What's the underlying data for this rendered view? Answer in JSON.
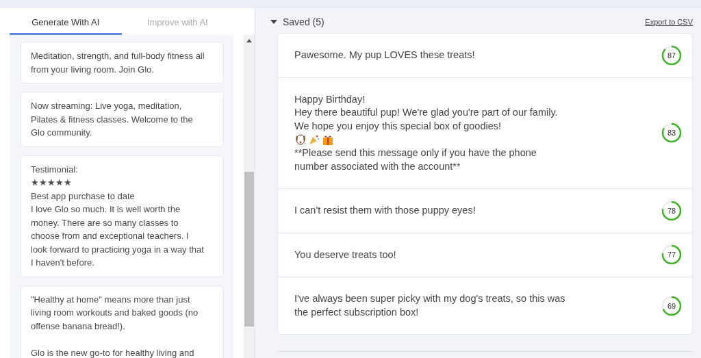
{
  "tabs": [
    {
      "label": "Generate With AI",
      "selected": true
    },
    {
      "label": "Improve with AI",
      "selected": false
    }
  ],
  "generated": [
    {
      "text": "Meditation, strength, and full-body fitness all from your living room. Join Glo."
    },
    {
      "text": "Now streaming: Live yoga, meditation, Pilates & fitness classes. Welcome to the Glo community."
    },
    {
      "text": "Testimonial:\n★★★★★\nBest app purchase to date\nI love Glo so much. It is well worth the money. There are so many classes to choose from and exceptional teachers. I look forward to practicing yoga in a way that I haven't before."
    },
    {
      "text": "\"Healthy at home\" means more than just living room workouts and baked goods (no offense banana bread!).\n\nGlo is the new go-to for healthy living and"
    }
  ],
  "saved": {
    "title": "Saved (5)",
    "expanded": true,
    "export_link": "Export to CSV",
    "messages": [
      {
        "parts": [
          {
            "kind": "text",
            "text": "Pawesome. My pup LOVES these treats!"
          }
        ],
        "score": "87"
      },
      {
        "parts": [
          {
            "kind": "text",
            "text": "Happy Birthday!\nHey there beautiful pup! We're glad you're part of our family.\nWe hope you enjoy this special box of goodies!"
          },
          {
            "kind": "emoji_row"
          },
          {
            "kind": "text",
            "text": "**Please send this message only if you have the phone\nnumber associated with the account**"
          }
        ],
        "score": "83"
      },
      {
        "parts": [
          {
            "kind": "text",
            "text": "I can't resist them with those puppy eyes!"
          }
        ],
        "score": "78"
      },
      {
        "parts": [
          {
            "kind": "text",
            "text": "You deserve treats too!"
          }
        ],
        "score": "77"
      },
      {
        "parts": [
          {
            "kind": "text",
            "text": "I've always been super picky with my dog's treats, so this was\nthe perfect subscription box!"
          }
        ],
        "score": "69"
      }
    ]
  }
}
